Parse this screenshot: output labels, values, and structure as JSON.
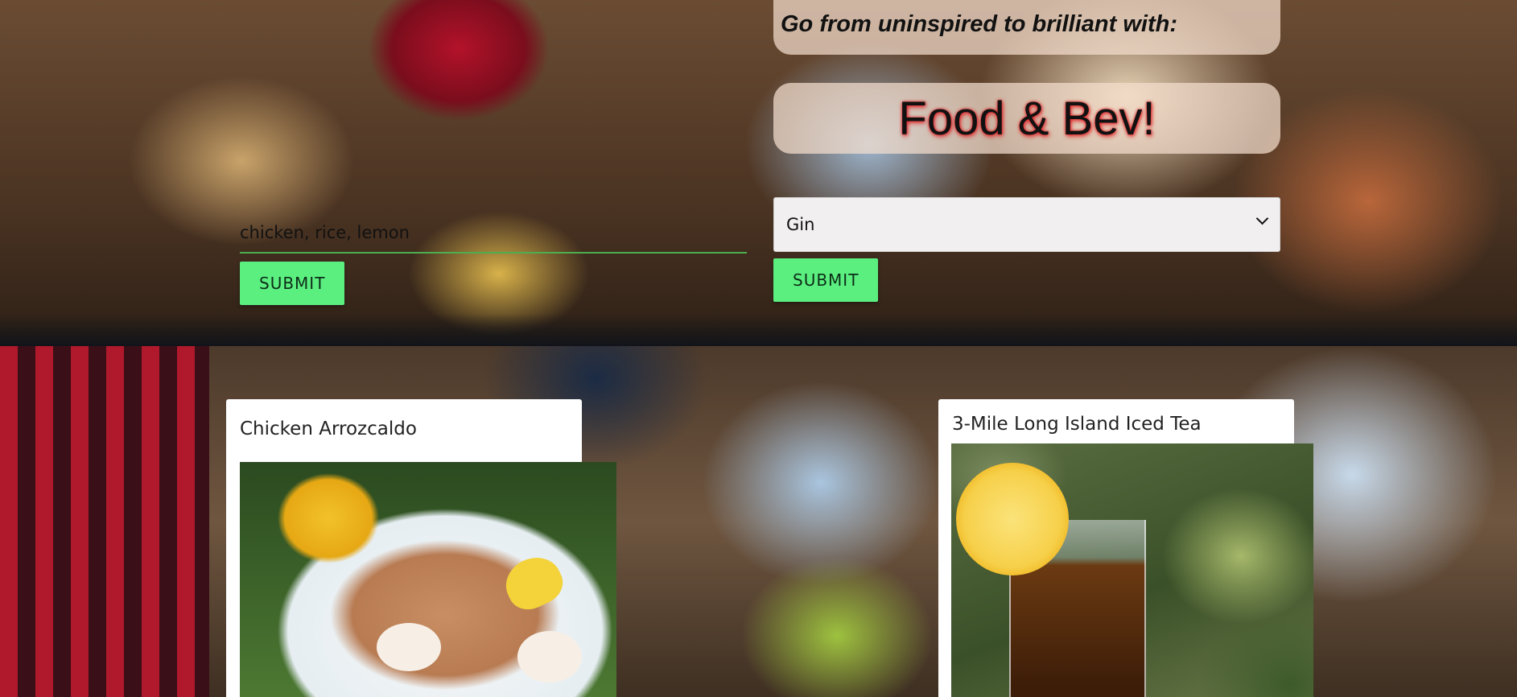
{
  "header": {
    "tagline": "Go from uninspired to brilliant with:",
    "brand": "Food & Bev!"
  },
  "food_search": {
    "input_value": "chicken, rice, lemon",
    "submit_label": "SUBMIT"
  },
  "bev_search": {
    "selected_option": "Gin",
    "submit_label": "SUBMIT"
  },
  "results": {
    "food_card": {
      "title": "Chicken Arrozcaldo",
      "photo_watermark": "..."
    },
    "bev_card": {
      "title": "3-Mile Long Island Iced Tea"
    }
  },
  "icons": {
    "select_arrow": "chevron-down-icon"
  },
  "colors": {
    "accent_button": "#5bef80",
    "input_underline": "#4caf50",
    "brand_glow": "#e0191e",
    "panel_tint": "#f4decd"
  }
}
